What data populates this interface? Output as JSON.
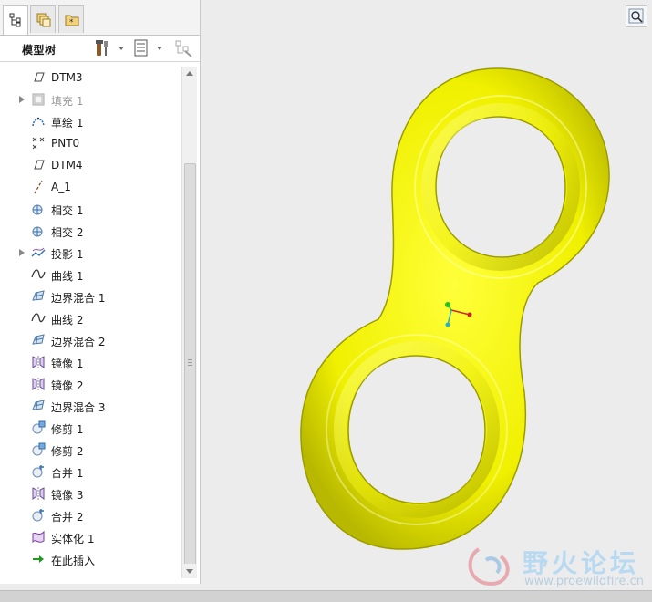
{
  "panel": {
    "title": "模型树"
  },
  "tree": [
    {
      "label": "DTM3",
      "icon": "datum-plane-icon",
      "expandable": false,
      "dim": false
    },
    {
      "label": "填充 1",
      "icon": "fill-icon",
      "expandable": true,
      "dim": true
    },
    {
      "label": "草绘 1",
      "icon": "sketch-icon",
      "expandable": false,
      "dim": false
    },
    {
      "label": "PNT0",
      "icon": "datum-point-icon",
      "expandable": false,
      "dim": false
    },
    {
      "label": "DTM4",
      "icon": "datum-plane-icon",
      "expandable": false,
      "dim": false
    },
    {
      "label": "A_1",
      "icon": "datum-axis-icon",
      "expandable": false,
      "dim": false
    },
    {
      "label": "相交 1",
      "icon": "intersect-icon",
      "expandable": false,
      "dim": false
    },
    {
      "label": "相交 2",
      "icon": "intersect-icon",
      "expandable": false,
      "dim": false
    },
    {
      "label": "投影 1",
      "icon": "project-icon",
      "expandable": true,
      "dim": false
    },
    {
      "label": "曲线 1",
      "icon": "curve-icon",
      "expandable": false,
      "dim": false
    },
    {
      "label": "边界混合 1",
      "icon": "boundary-blend-icon",
      "expandable": false,
      "dim": false
    },
    {
      "label": "曲线 2",
      "icon": "curve-icon",
      "expandable": false,
      "dim": false
    },
    {
      "label": "边界混合 2",
      "icon": "boundary-blend-icon",
      "expandable": false,
      "dim": false
    },
    {
      "label": "镜像 1",
      "icon": "mirror-icon",
      "expandable": false,
      "dim": false
    },
    {
      "label": "镜像 2",
      "icon": "mirror-icon",
      "expandable": false,
      "dim": false
    },
    {
      "label": "边界混合 3",
      "icon": "boundary-blend-icon",
      "expandable": false,
      "dim": false
    },
    {
      "label": "修剪 1",
      "icon": "trim-icon",
      "expandable": false,
      "dim": false
    },
    {
      "label": "修剪 2",
      "icon": "trim-icon",
      "expandable": false,
      "dim": false
    },
    {
      "label": "合并 1",
      "icon": "merge-icon",
      "expandable": false,
      "dim": false
    },
    {
      "label": "镜像 3",
      "icon": "mirror-icon",
      "expandable": false,
      "dim": false
    },
    {
      "label": "合并 2",
      "icon": "merge-icon",
      "expandable": false,
      "dim": false
    },
    {
      "label": "实体化 1",
      "icon": "solidify-icon",
      "expandable": false,
      "dim": false
    },
    {
      "label": "在此插入",
      "icon": "insert-here-arrow-icon",
      "expandable": false,
      "dim": false
    }
  ],
  "watermark": {
    "main": "野火论坛",
    "sub": "www.proewildfire.cn"
  },
  "colors": {
    "model_yellow": "#f2f200",
    "model_shadow": "#a8a800",
    "accent_blue": "#2a6fb8",
    "insert_arrow": "#1f9a1f"
  }
}
